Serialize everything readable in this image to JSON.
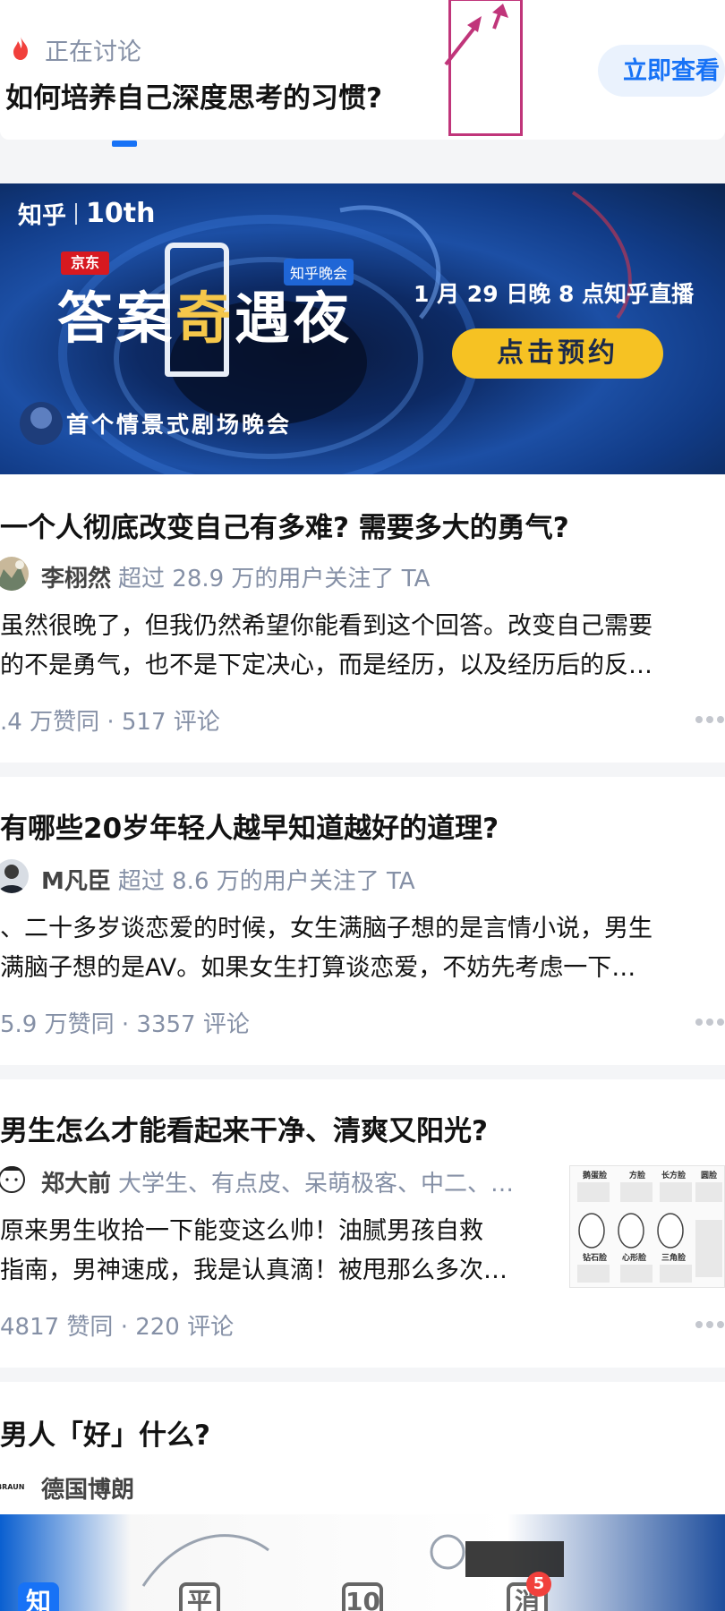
{
  "hot": {
    "label": "正在讨论",
    "question": "如何培养自己深度思考的习惯?",
    "button": "立即查看"
  },
  "banner": {
    "brand": "知乎",
    "brand_tenth": "10th",
    "jd": "京东",
    "tag": "知乎晚会",
    "title_1": "答案",
    "title_2": "奇",
    "title_3": "遇夜",
    "date": "1 月 29 日晚 8 点知乎直播",
    "cta": "点击预约",
    "subtitle": "首个情景式剧场晚会"
  },
  "feed": [
    {
      "title": "一个人彻底改变自己有多难? 需要多大的勇气?",
      "author": "李栩然",
      "author_meta": "超过 28.9 万的用户关注了 TA",
      "excerpt_1": "虽然很晚了，但我仍然希望你能看到这个回答。改变自己需要",
      "excerpt_2": "的不是勇气，也不是下定决心，而是经历，以及经历后的反…",
      "stats": ".4 万赞同 · 517 评论"
    },
    {
      "title": "有哪些20岁年轻人越早知道越好的道理?",
      "author": "M凡臣",
      "author_meta": "超过 8.6 万的用户关注了 TA",
      "excerpt_1": "、二十多岁谈恋爱的时候，女生满脑子想的是言情小说，男生",
      "excerpt_2": "满脑子想的是AV。如果女生打算谈恋爱，不妨先考虑一下…",
      "stats": "5.9 万赞同 · 3357 评论"
    },
    {
      "title": "男生怎么才能看起来干净、清爽又阳光?",
      "author": "郑大前",
      "author_meta": "大学生、有点皮、呆萌极客、中二、…",
      "excerpt_1": "原来男生收拾一下能变这么帅！油腻男孩自救",
      "excerpt_2": "指南，男神速成，我是认真滴！被甩那么多次…",
      "stats": "4817 赞同 · 220 评论",
      "thumb_labels": [
        "鹅蛋脸",
        "方脸",
        "长方脸",
        "圆脸",
        "钻石脸",
        "心形脸",
        "三角脸"
      ]
    },
    {
      "title": "男人「好」什么?",
      "author": "德国博朗",
      "avatar_text": "BRAUN"
    }
  ],
  "tabbar": {
    "tabs": [
      "知",
      "平",
      "10",
      "消"
    ],
    "badge": "5"
  }
}
